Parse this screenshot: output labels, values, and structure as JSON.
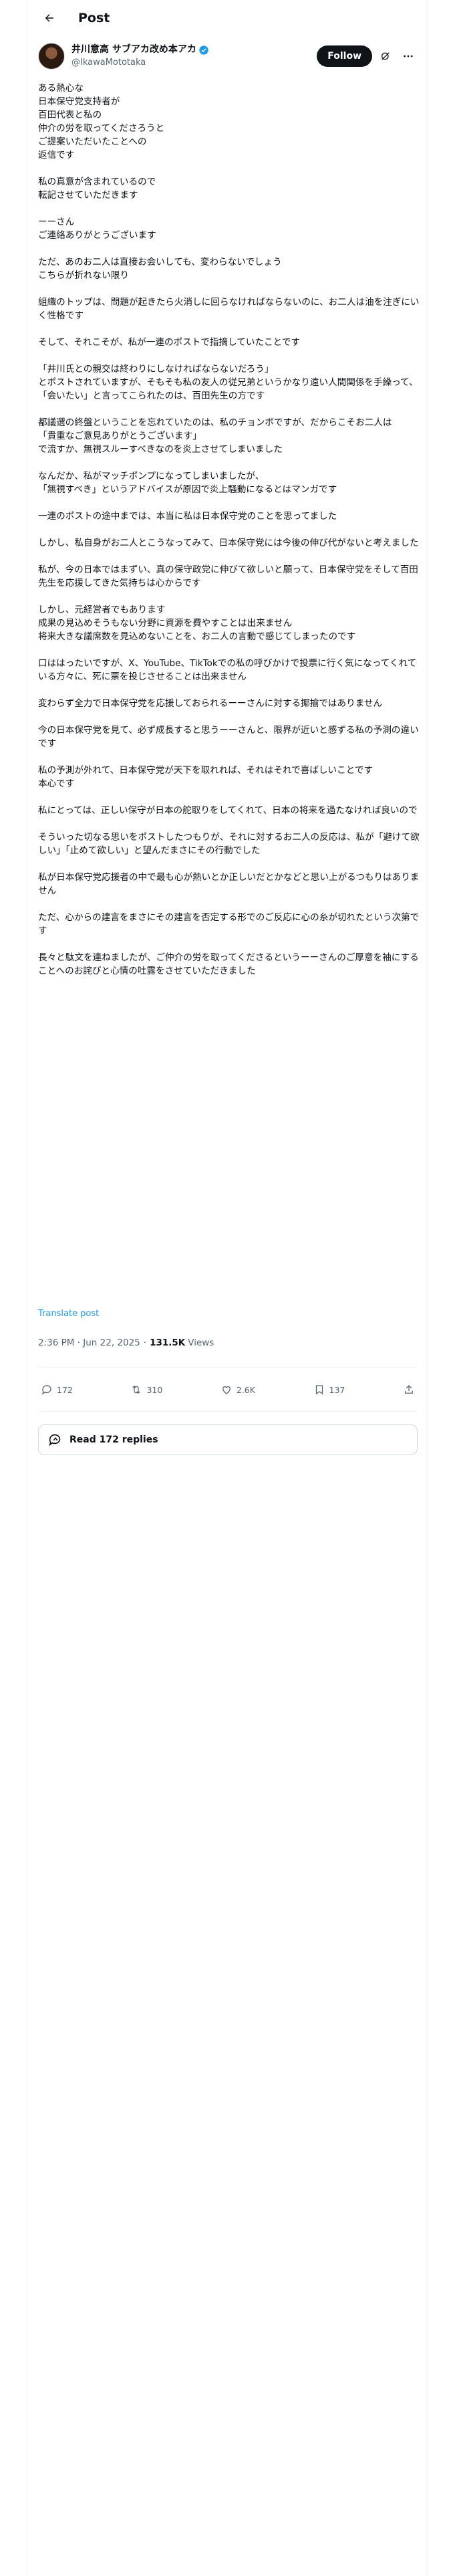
{
  "header": {
    "title": "Post"
  },
  "author": {
    "display_name": "井川意高 サブアカ改め本アカ",
    "handle": "@IkawaMototaka",
    "follow_label": "Follow"
  },
  "post": {
    "body": "ある熱心な\n日本保守党支持者が\n百田代表と私の\n仲介の労を取ってくださろうと\nご提案いただいたことへの\n返信です\n\n私の真意が含まれているので\n転記させていただきます\n\nーーさん\nご連絡ありがとうございます\n\nただ、あのお二人は直接お会いしても、変わらないでしょう\nこちらが折れない限り\n\n組織のトップは、問題が起きたら火消しに回らなければならないのに、お二人は油を注ぎにいく性格です\n\nそして、それこそが、私が一連のポストで指摘していたことです\n\n「井川氏との親交は終わりにしなければならないだろう」\nとポストされていますが、そもそも私の友人の従兄弟というかなり遠い人間関係を手繰って、\n「会いたい」と言ってこられたのは、百田先生の方です\n\n都議選の終盤ということを忘れていたのは、私のチョンボですが、だからこそお二人は\n「貴重なご意見ありがとうございます」\nで流すか、無視スルーすべきなのを炎上させてしまいました\n\nなんだか、私がマッチポンプになってしまいましたが、\n「無視すべき」というアドバイスが原因で炎上騒動になるとはマンガです\n\n一連のポストの途中までは、本当に私は日本保守党のことを思ってました\n\nしかし、私自身がお二人とこうなってみて、日本保守党には今後の伸び代がないと考えました\n\n私が、今の日本ではまずい、真の保守政党に伸びて欲しいと願って、日本保守党をそして百田先生を応援してきた気持ちは心からです\n\nしかし、元経営者でもあります\n成果の見込めそうもない分野に資源を費やすことは出来ません\n将来大きな議席数を見込めないことを、お二人の言動で感じてしまったのです\n\n口ははったいですが、X、YouTube、TikTokでの私の呼びかけで投票に行く気になってくれている方々に、死に票を投じさせることは出来ません\n\n変わらず全力で日本保守党を応援しておられるーーさんに対する揶揄ではありません\n\n今の日本保守党を見て、必ず成長すると思うーーさんと、限界が近いと感ずる私の予測の違いです\n\n私の予測が外れて、日本保守党が天下を取れれば、それはそれで喜ばしいことです\n本心です\n\n私にとっては、正しい保守が日本の舵取りをしてくれて、日本の将来を過たなければ良いので\n\nそういった切なる思いをポストしたつもりが、それに対するお二人の反応は、私が「避けて欲しい」「止めて欲しい」と望んだまさにその行動でした\n\n私が日本保守党応援者の中で最も心が熱いとか正しいだとかなどと思い上がるつもりはありません\n\nただ、心からの建言をまさにその建言を否定する形でのご反応に心の糸が切れたという次第です\n\n長々と駄文を連ねましたが、ご仲介の労を取ってくださるというーーさんのご厚意を袖にすることへのお詫びと心情の吐露をさせていただきました",
    "translate_label": "Translate post",
    "time": "2:36 PM · Jun 22, 2025",
    "views_count": "131.5K",
    "views_label": "Views"
  },
  "engagement": {
    "replies": "172",
    "reposts": "310",
    "likes": "2.6K",
    "bookmarks": "137"
  },
  "read_replies_label": "Read 172 replies",
  "colors": {
    "accent": "#1d9bf0",
    "text": "#0f1419",
    "muted": "#536471"
  },
  "icons": [
    "back-arrow-icon",
    "verified-badge-icon",
    "grok-icon",
    "more-icon",
    "reply-icon",
    "repost-icon",
    "like-icon",
    "bookmark-icon",
    "share-icon",
    "speech-bubble-icon"
  ]
}
